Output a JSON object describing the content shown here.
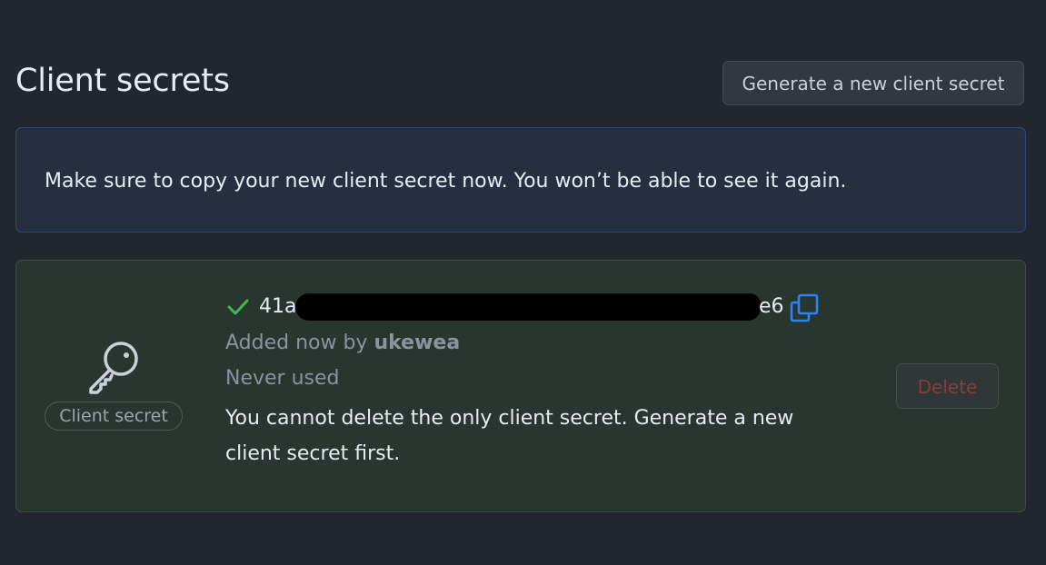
{
  "header": {
    "title": "Client secrets",
    "generate_button": "Generate a new client secret"
  },
  "flash": {
    "message": "Make sure to copy your new client secret now. You won’t be able to see it again."
  },
  "secret": {
    "type_label": "Client secret",
    "value_prefix": "41a",
    "value_suffix": "e6",
    "added_text": "Added now by ",
    "added_by": "ukewea",
    "usage": "Never used",
    "note": "You cannot delete the only client secret. Generate a new client secret first.",
    "delete_button": "Delete",
    "icons": {
      "type": "key-icon",
      "status": "check-icon",
      "copy": "copy-icon"
    }
  },
  "colors": {
    "background": "#22262e",
    "flash_bg": "#252f40",
    "card_bg": "#29352f",
    "success": "#3fb950",
    "copy_icon": "#2f81f7",
    "danger_disabled": "#8c3a3a"
  }
}
